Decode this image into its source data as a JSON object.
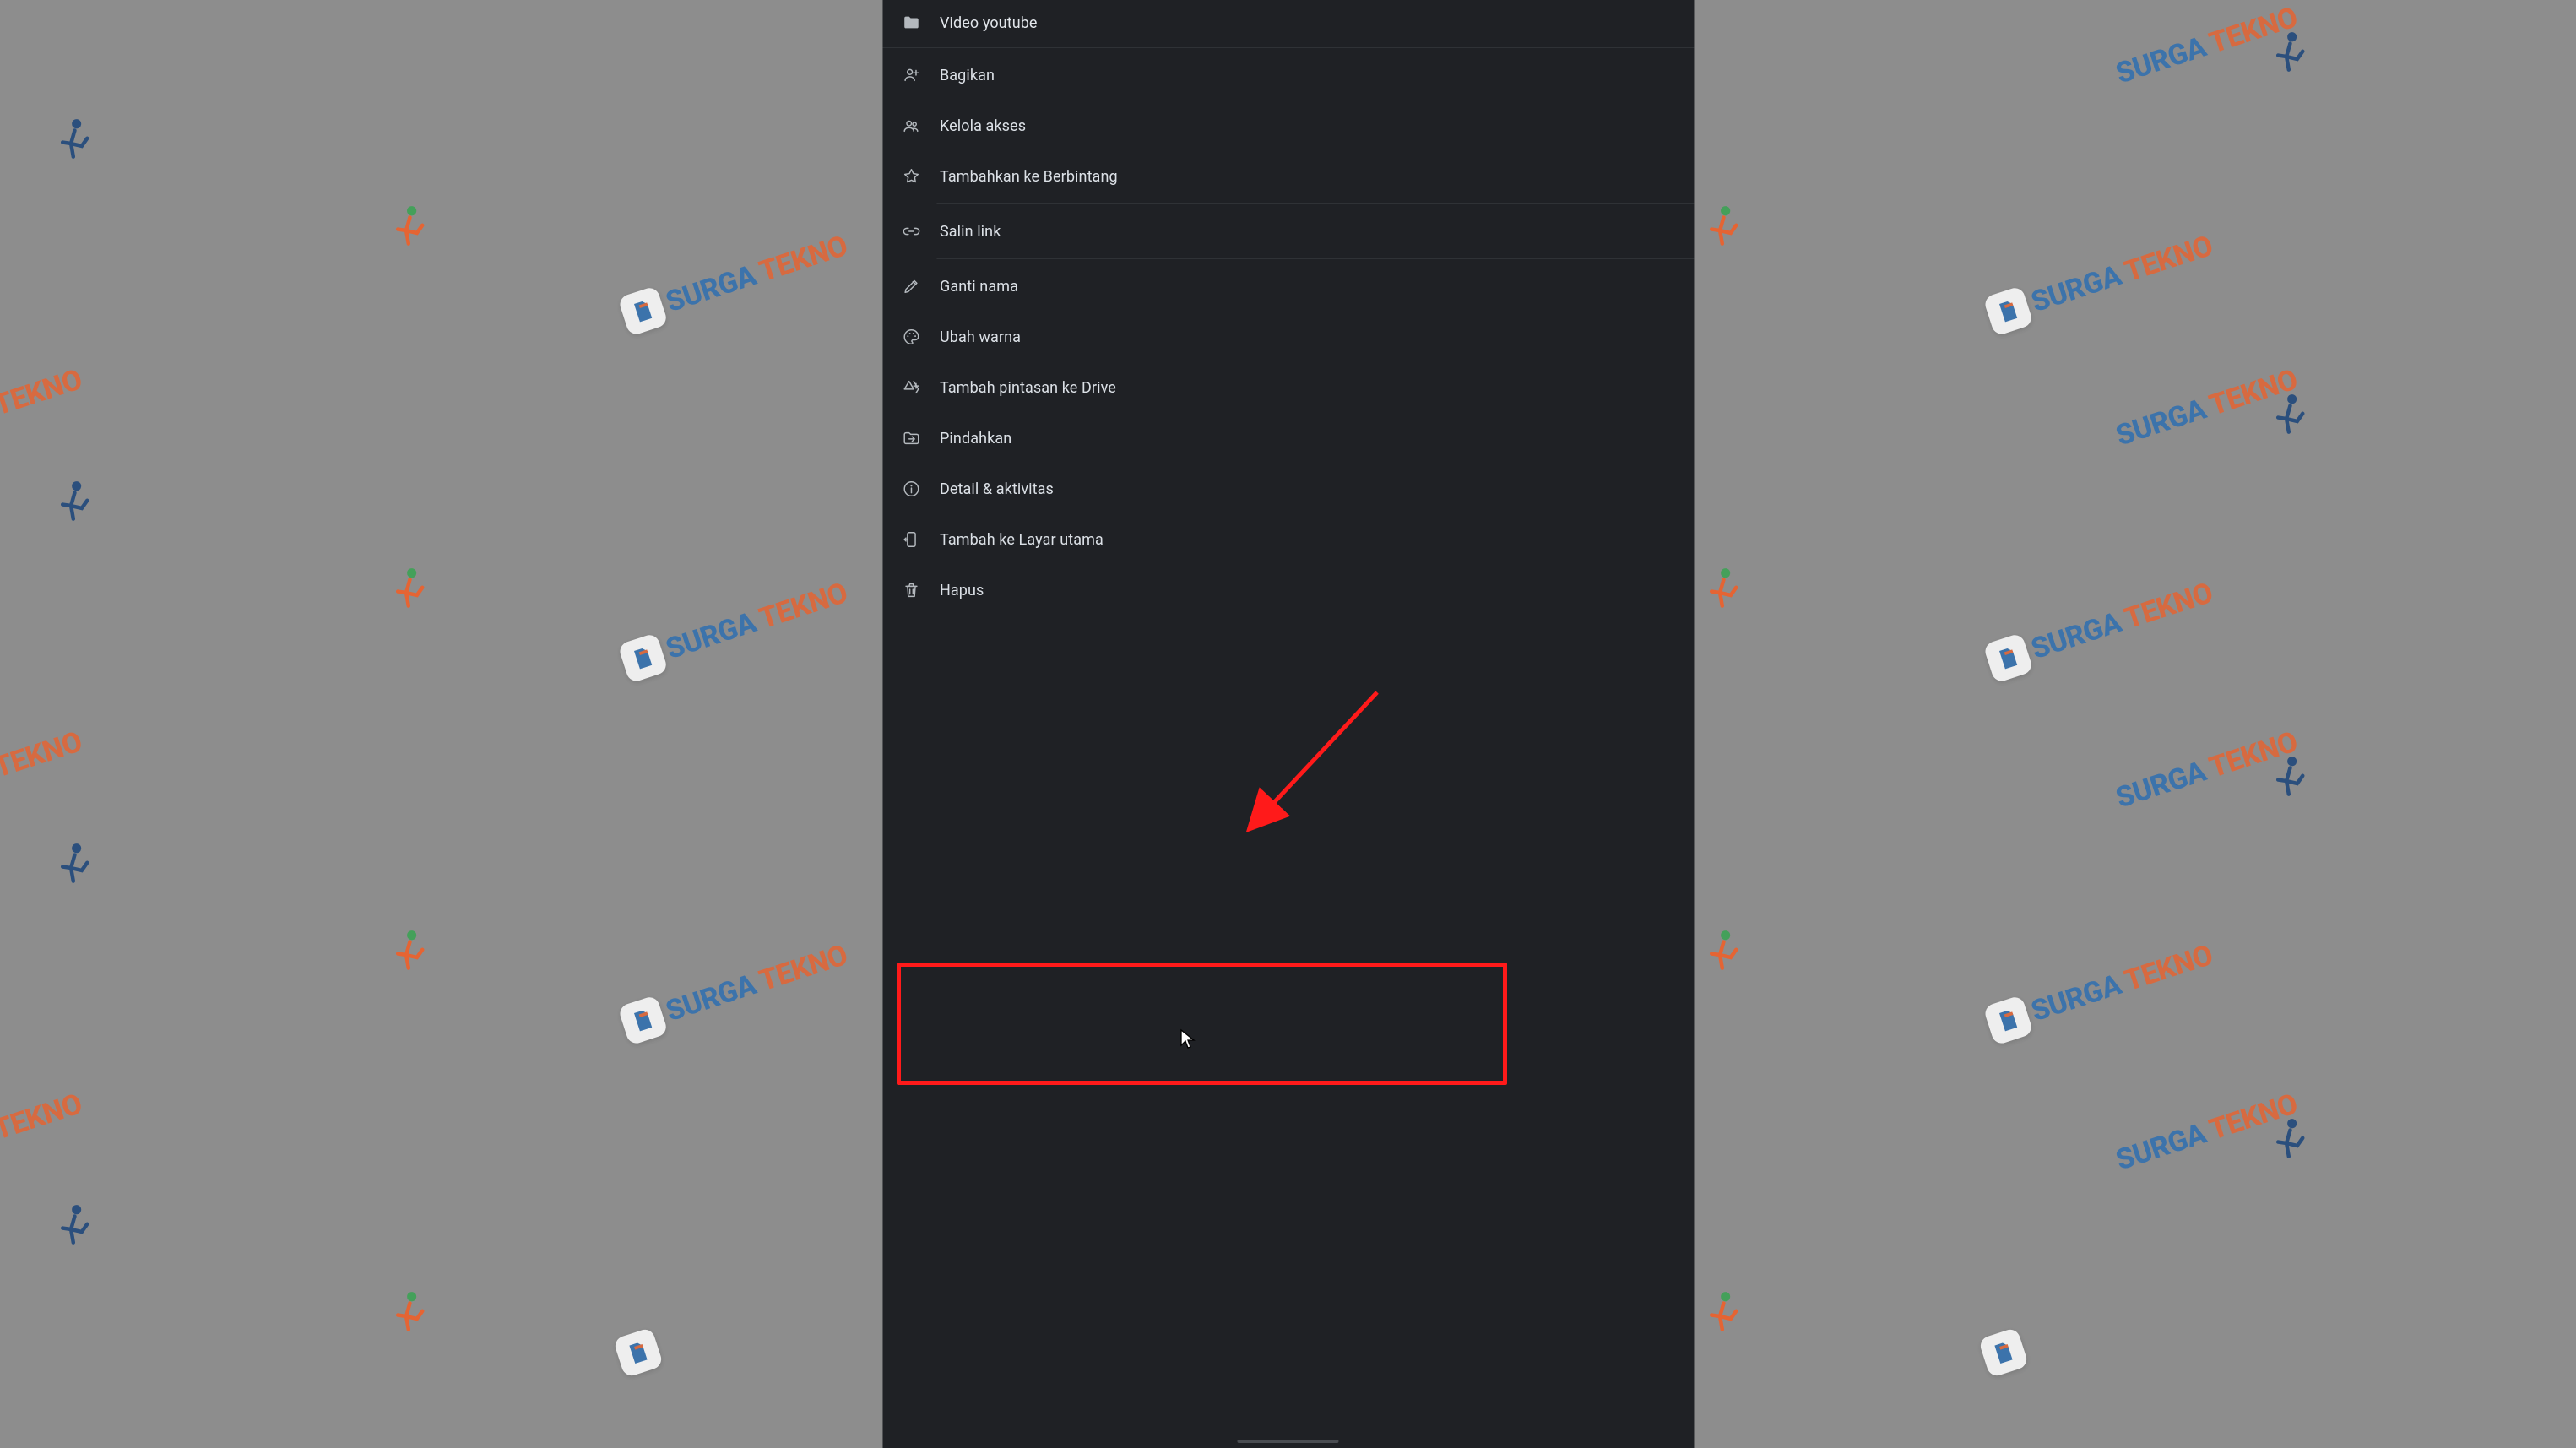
{
  "menu": {
    "header": {
      "label": "Video youtube"
    },
    "share": {
      "label": "Bagikan"
    },
    "manage_access": {
      "label": "Kelola akses"
    },
    "add_starred": {
      "label": "Tambahkan ke Berbintang"
    },
    "copy_link": {
      "label": "Salin link"
    },
    "rename": {
      "label": "Ganti nama"
    },
    "change_color": {
      "label": "Ubah warna"
    },
    "add_shortcut": {
      "label": "Tambah pintasan ke Drive"
    },
    "move": {
      "label": "Pindahkan"
    },
    "details": {
      "label": "Detail & aktivitas"
    },
    "add_homescreen": {
      "label": "Tambah ke Layar utama"
    },
    "remove": {
      "label": "Hapus"
    }
  },
  "watermark": {
    "brand_part1": "SURGA",
    "brand_part2": " TEKNO"
  },
  "annotation": {
    "highlighted_item": "move",
    "highlight_color": "#ff1a1a"
  }
}
